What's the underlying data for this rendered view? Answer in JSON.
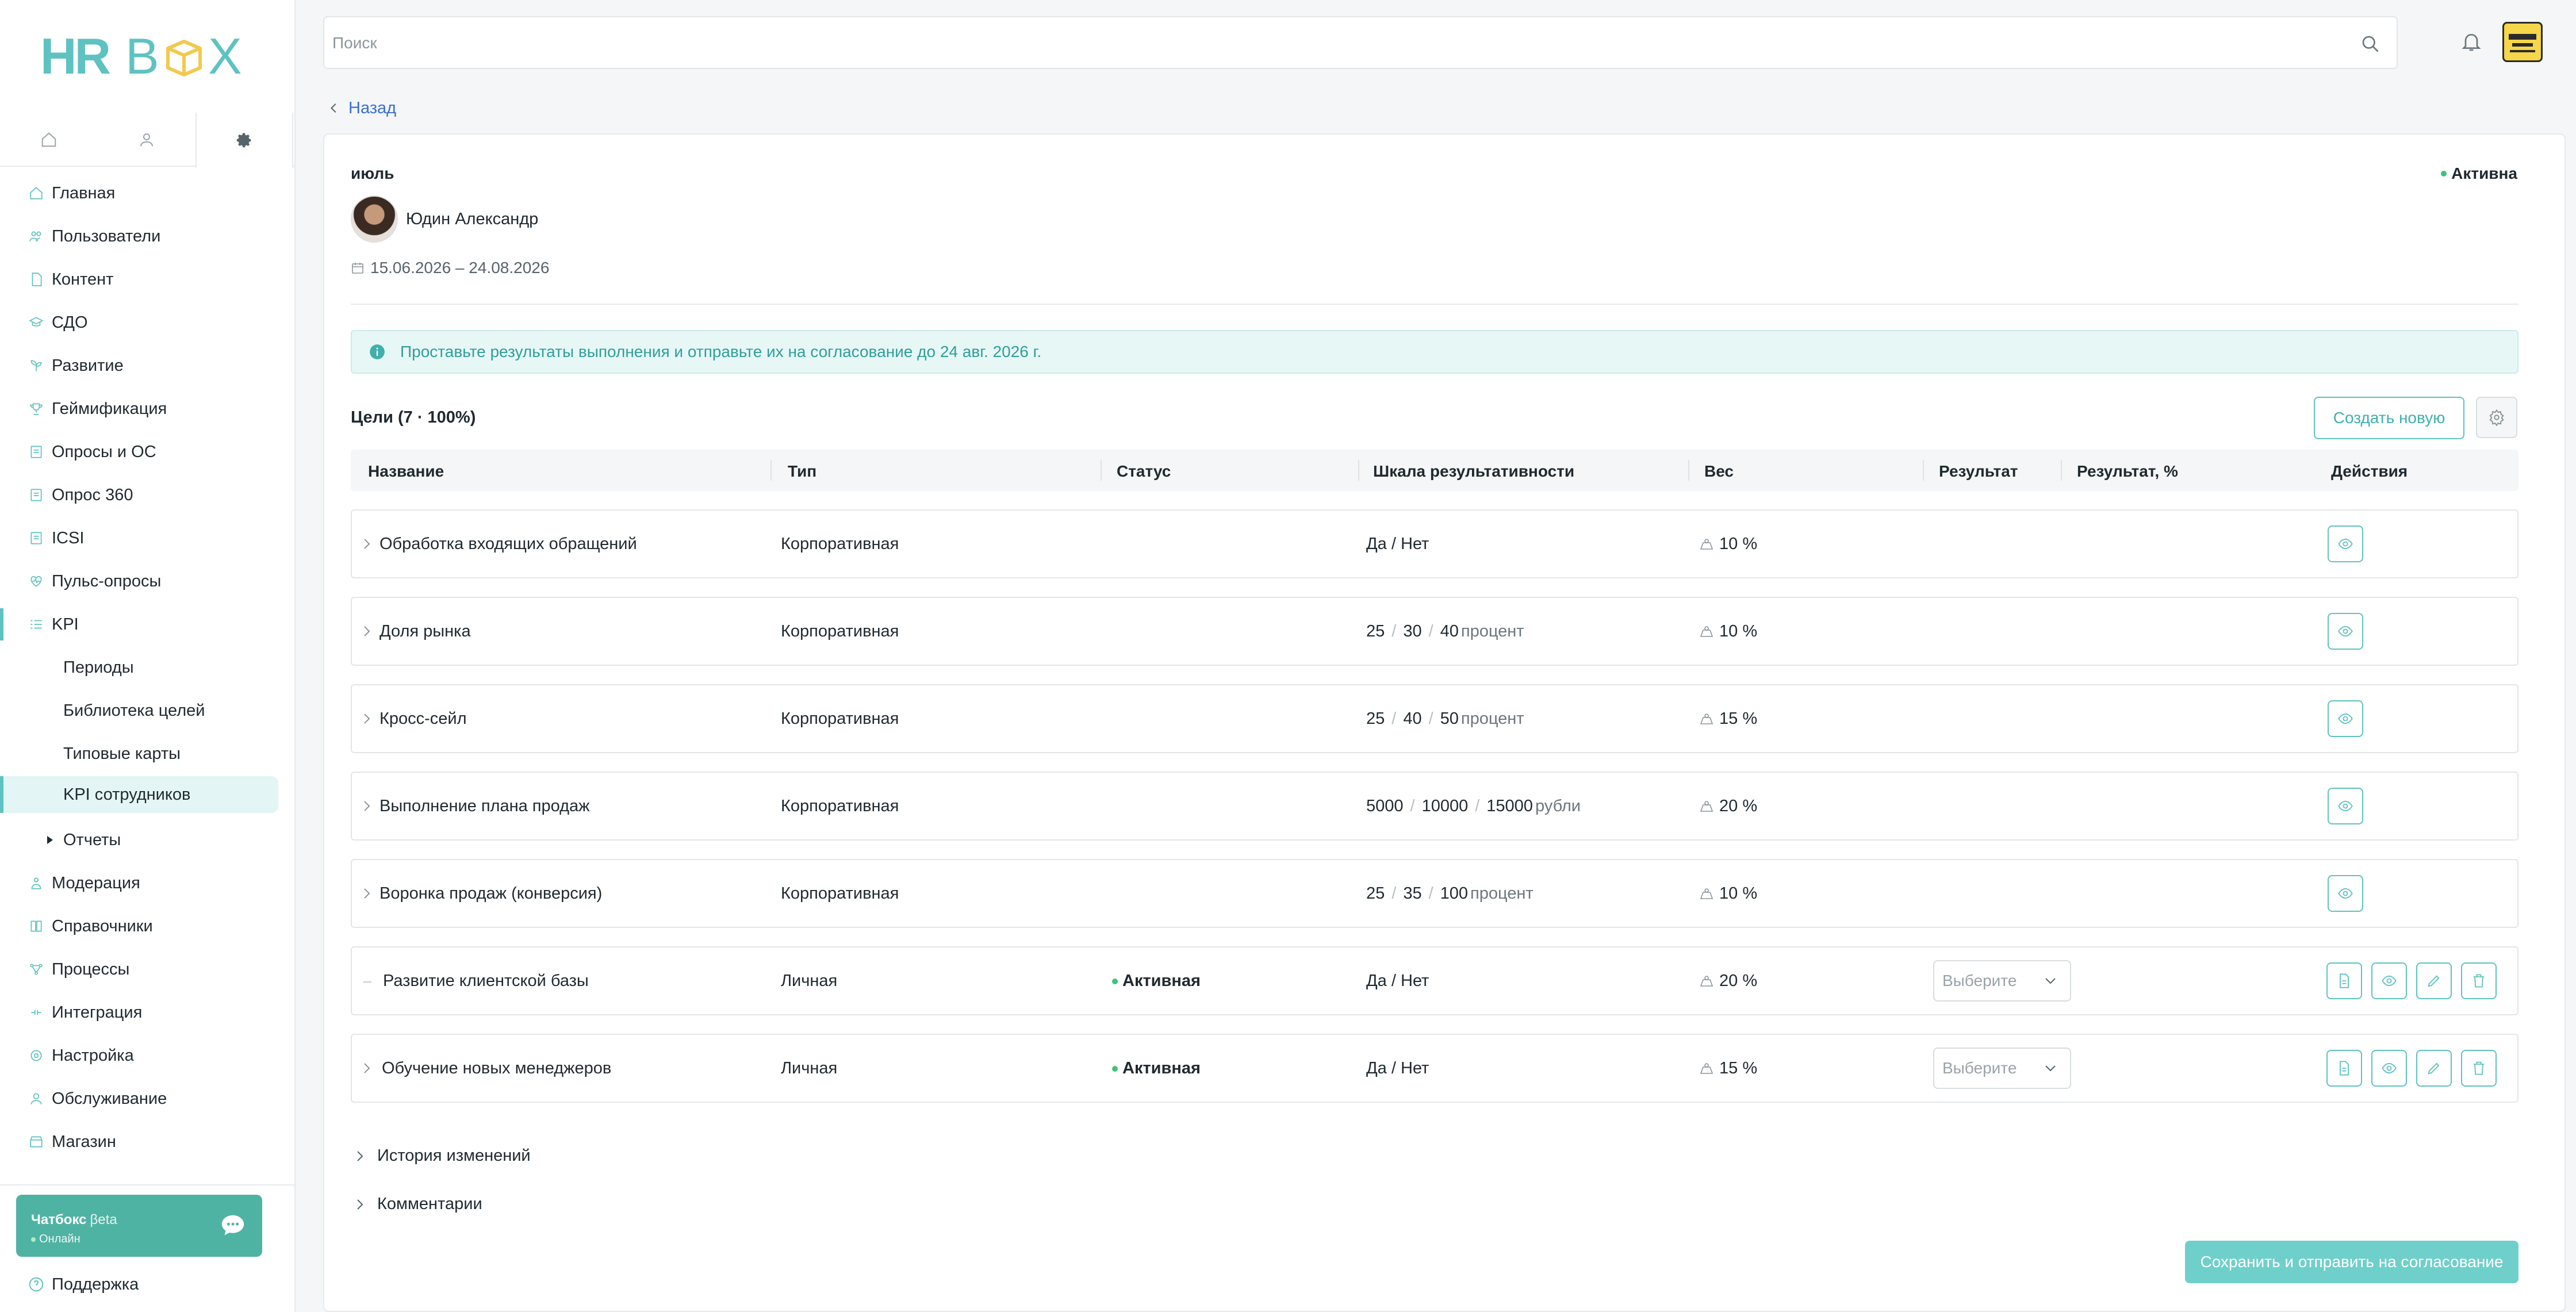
{
  "brand": {
    "logo_text": "HRBOX",
    "accent": "#5ec3c0"
  },
  "sidebar": {
    "tabs": [
      {
        "icon": "home-icon"
      },
      {
        "icon": "user-icon"
      },
      {
        "icon": "gear-icon"
      }
    ],
    "items": [
      {
        "label": "Главная",
        "icon": "home-icon"
      },
      {
        "label": "Пользователи",
        "icon": "users-icon"
      },
      {
        "label": "Контент",
        "icon": "file-icon"
      },
      {
        "label": "СДО",
        "icon": "graduation-cap-icon"
      },
      {
        "label": "Развитие",
        "icon": "sprout-icon"
      },
      {
        "label": "Геймификация",
        "icon": "trophy-icon"
      },
      {
        "label": "Опросы и ОС",
        "icon": "survey-icon"
      },
      {
        "label": "Опрос 360",
        "icon": "survey-icon"
      },
      {
        "label": "ICSI",
        "icon": "survey-icon"
      },
      {
        "label": "Пульс-опросы",
        "icon": "pulse-icon"
      },
      {
        "label": "KPI",
        "icon": "kpi-icon"
      },
      {
        "label": "Периоды"
      },
      {
        "label": "Библиотека целей"
      },
      {
        "label": "Типовые карты"
      },
      {
        "label": "KPI сотрудников"
      },
      {
        "label": "Отчеты"
      },
      {
        "label": "Модерация",
        "icon": "moderation-icon"
      },
      {
        "label": "Справочники",
        "icon": "book-icon"
      },
      {
        "label": "Процессы",
        "icon": "process-icon"
      },
      {
        "label": "Интеграция",
        "icon": "integration-icon"
      },
      {
        "label": "Настройка",
        "icon": "gear-icon"
      },
      {
        "label": "Обслуживание",
        "icon": "service-icon"
      },
      {
        "label": "Магазин",
        "icon": "store-icon"
      }
    ],
    "chatbox": {
      "title": "Чатбокс",
      "badge": "βeta",
      "status": "Онлайн"
    },
    "support": "Поддержка"
  },
  "header": {
    "search_placeholder": "Поиск"
  },
  "main": {
    "back": "Назад",
    "period": "июль",
    "status": "Активна",
    "employee": "Юдин Александр",
    "dates": "15.06.2026 – 24.08.2026",
    "alert": "Проставьте результаты выполнения и отправьте их на согласование до 24 авг. 2026 г.",
    "goals_title": "Цели (7 · 100%)",
    "create_button": "Создать новую",
    "columns": [
      "Название",
      "Тип",
      "Статус",
      "Шкала результативности",
      "Вес",
      "Результат",
      "Результат, %",
      "Действия"
    ],
    "rows": [
      {
        "name": "Обработка входящих обращений",
        "type": "Корпоративная",
        "status": "",
        "scale": [
          "Да / Нет"
        ],
        "unit": "",
        "weight": "10 %",
        "result": "",
        "actions": [
          "view"
        ]
      },
      {
        "name": "Доля рынка",
        "type": "Корпоративная",
        "status": "",
        "scale": [
          "25",
          "30",
          "40"
        ],
        "unit": "процент",
        "weight": "10 %",
        "result": "",
        "actions": [
          "view"
        ]
      },
      {
        "name": "Кросс-сейл",
        "type": "Корпоративная",
        "status": "",
        "scale": [
          "25",
          "40",
          "50"
        ],
        "unit": "процент",
        "weight": "15 %",
        "result": "",
        "actions": [
          "view"
        ]
      },
      {
        "name": "Выполнение плана продаж",
        "type": "Корпоративная",
        "status": "",
        "scale": [
          "5000",
          "10000",
          "15000"
        ],
        "unit": "рубли",
        "weight": "20 %",
        "result": "",
        "actions": [
          "view"
        ]
      },
      {
        "name": "Воронка продаж (конверсия)",
        "type": "Корпоративная",
        "status": "",
        "scale": [
          "25",
          "35",
          "100"
        ],
        "unit": "процент",
        "weight": "10 %",
        "result": "",
        "actions": [
          "view"
        ]
      },
      {
        "name": "Развитие клиентской базы",
        "type": "Личная",
        "status": "Активная",
        "scale": [
          "Да / Нет"
        ],
        "unit": "",
        "weight": "20 %",
        "result": "Выберите",
        "actions": [
          "document",
          "view",
          "edit",
          "delete"
        ]
      },
      {
        "name": "Обучение новых менеджеров",
        "type": "Личная",
        "status": "Активная",
        "scale": [
          "Да / Нет"
        ],
        "unit": "",
        "weight": "15 %",
        "result": "Выберите",
        "actions": [
          "document",
          "view",
          "edit",
          "delete"
        ]
      }
    ],
    "history": "История изменений",
    "comments": "Комментарии",
    "save_button": "Сохранить и отправить на согласование"
  }
}
